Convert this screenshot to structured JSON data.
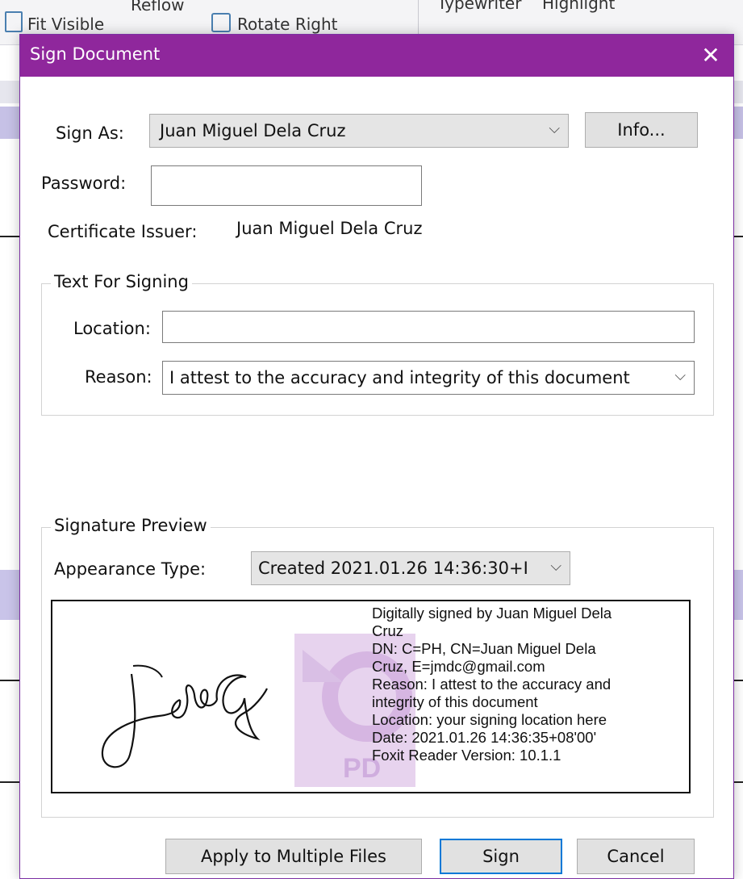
{
  "background": {
    "toolbar": {
      "fit_visible": "Fit Visible",
      "reflow": "Reflow",
      "rotate_right": "Rotate Right",
      "typewriter": "Typewriter",
      "highlight": "Highlight"
    }
  },
  "dialog": {
    "title": "Sign Document",
    "close_glyph": "✕",
    "sign_as": {
      "label": "Sign As:",
      "value": "Juan Miguel Dela Cruz",
      "info_button": "Info..."
    },
    "password": {
      "label": "Password:",
      "value": ""
    },
    "certificate_issuer": {
      "label": "Certificate Issuer:",
      "value": "Juan Miguel Dela Cruz"
    },
    "text_for_signing": {
      "title": "Text For Signing",
      "location_label": "Location:",
      "location_value": "",
      "reason_label": "Reason:",
      "reason_value": "I attest to the accuracy and integrity of this document"
    },
    "signature_preview": {
      "title": "Signature Preview",
      "appearance_label": "Appearance Type:",
      "appearance_value": "Created 2021.01.26 14:36:30+I",
      "details": {
        "line1": "Digitally signed by Juan Miguel Dela",
        "line2": "Cruz",
        "line3": "DN: C=PH, CN=Juan Miguel Dela",
        "line4": "Cruz, E=jmdc@gmail.com",
        "line5": "Reason: I attest to the accuracy and",
        "line6": "integrity of this document",
        "line7": "Location: your signing location here",
        "line8": "Date: 2021.01.26 14:36:35+08'00'",
        "line9": "Foxit Reader Version: 10.1.1"
      },
      "watermark_text": "PD"
    },
    "buttons": {
      "apply_multiple": "Apply to Multiple Files",
      "sign": "Sign",
      "cancel": "Cancel"
    }
  },
  "colors": {
    "titlebar": "#8f279c",
    "default_button_border": "#0078d7",
    "band": "#c6c1e6"
  }
}
